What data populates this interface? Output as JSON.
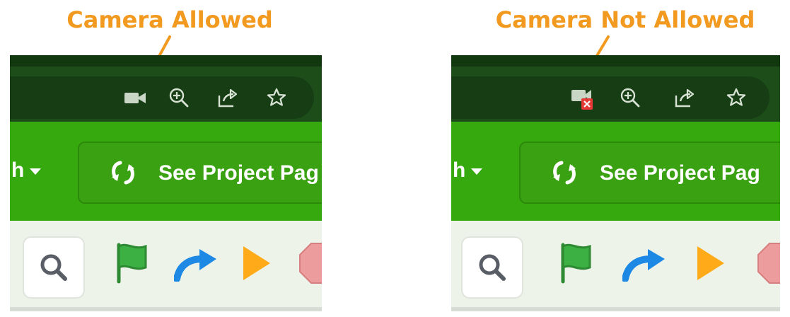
{
  "left": {
    "title": "Camera Allowed",
    "camera_icon": "video-camera-icon",
    "menu_fragment": "h",
    "project_button_label": "See Project Pag"
  },
  "right": {
    "title": "Camera Not Allowed",
    "camera_icon": "video-camera-blocked-icon",
    "menu_fragment": "h",
    "project_button_label": "See Project Pag"
  },
  "toolbar_icons": [
    "zoom-in-icon",
    "share-icon",
    "bookmark-star-icon"
  ],
  "editor_icons": [
    "search-icon",
    "green-flag-icon",
    "redo-arrow-icon",
    "play-icon",
    "stop-icon"
  ],
  "colors": {
    "annotation": "#f29a1f",
    "chrome_dark": "#11380f",
    "chrome_bar": "#1d4e19",
    "omnibox": "#163d13",
    "menu_green": "#36a90e",
    "blocked_badge": "#e53935",
    "flag_green": "#3cb043",
    "arrow_blue": "#1e88e5",
    "play_orange": "#ffab19",
    "stop_red": "#ec9c9c"
  }
}
